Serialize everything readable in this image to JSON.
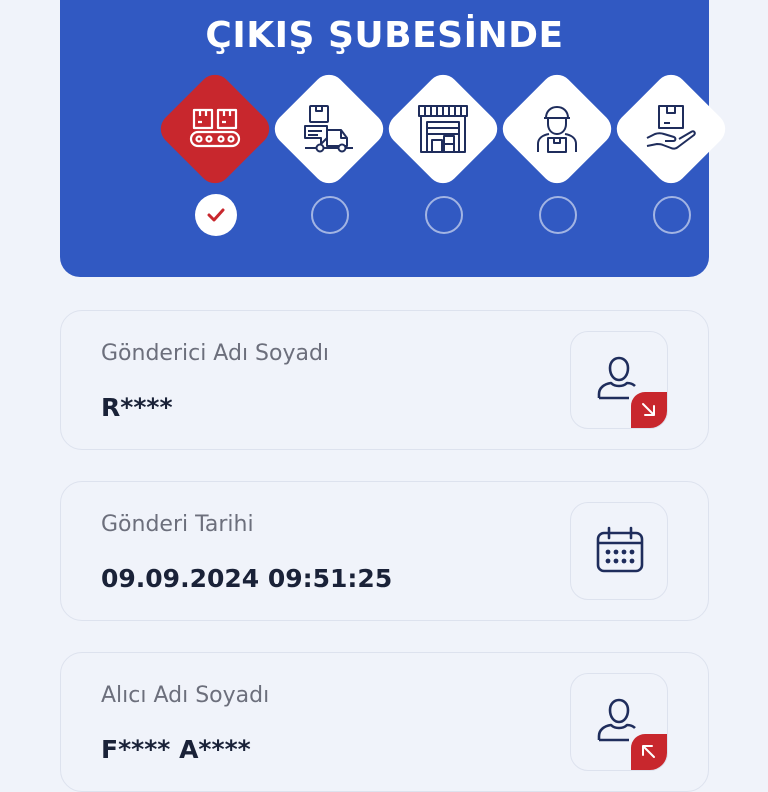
{
  "status": {
    "title": "ÇIKIŞ ŞUBESİNDE",
    "steps": [
      {
        "icon": "conveyor-boxes-icon",
        "active": true,
        "done": true
      },
      {
        "icon": "delivery-truck-icon",
        "active": false,
        "done": false
      },
      {
        "icon": "warehouse-icon",
        "active": false,
        "done": false
      },
      {
        "icon": "courier-icon",
        "active": false,
        "done": false
      },
      {
        "icon": "hand-package-icon",
        "active": false,
        "done": false
      }
    ]
  },
  "sender": {
    "label": "Gönderici Adı Soyadı",
    "value": "R****",
    "icon": "person-outgoing-icon"
  },
  "shipment_date": {
    "label": "Gönderi Tarihi",
    "value": "09.09.2024 09:51:25",
    "icon": "calendar-icon"
  },
  "recipient": {
    "label": "Alıcı Adı Soyadı",
    "value": "F**** A****",
    "icon": "person-incoming-icon"
  },
  "colors": {
    "brand_blue": "#3159c2",
    "accent_red": "#c8272d",
    "icon_navy": "#1f2d5c"
  }
}
